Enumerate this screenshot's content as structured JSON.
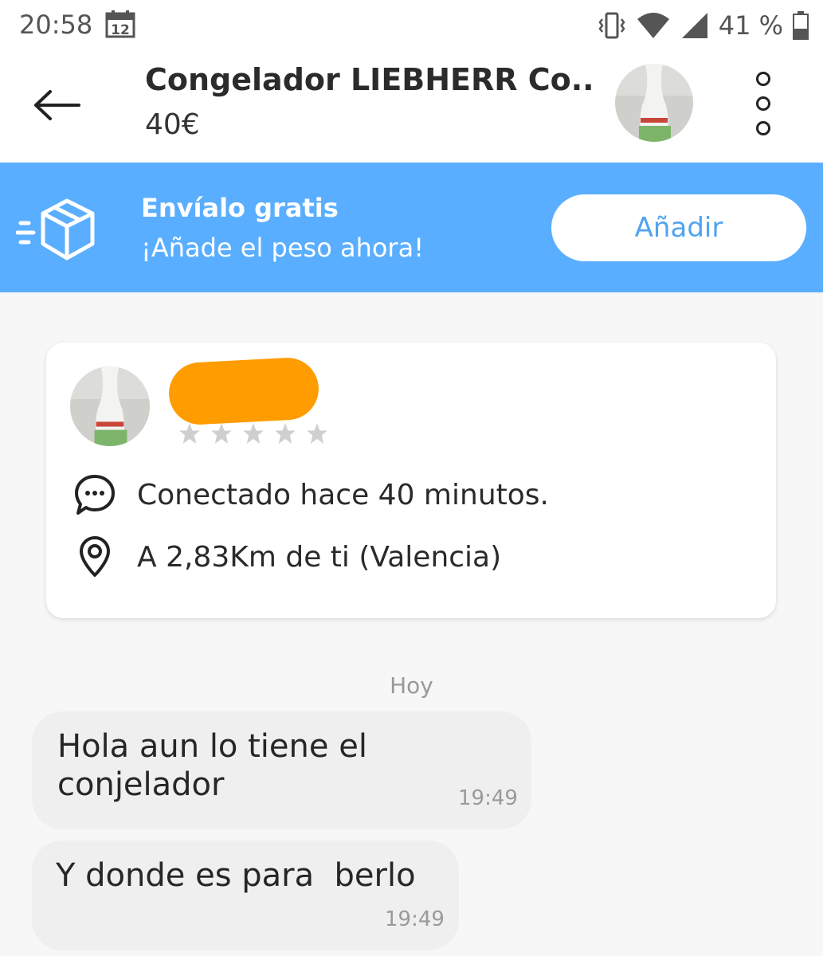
{
  "status_bar": {
    "time": "20:58",
    "calendar_day": "12",
    "battery": "41 %"
  },
  "header": {
    "title": "Congelador LIEBHERR Co...",
    "price": "40€"
  },
  "promo": {
    "title": "Envíalo gratis",
    "subtitle": "¡Añade el peso ahora!",
    "button_label": "Añadir",
    "background_color": "#5aaeff"
  },
  "seller_card": {
    "rating_stars": 5,
    "rating_value": 0,
    "last_seen": "Conectado hace 40 minutos.",
    "distance": "A 2,83Km de ti (Valencia)"
  },
  "chat": {
    "day_label": "Hoy",
    "messages": [
      {
        "text_line1": "Hola aun lo tiene el",
        "text_line2": "conjelador",
        "time": "19:49"
      },
      {
        "text": "Y donde es para  berlo",
        "time": "19:49"
      }
    ]
  }
}
